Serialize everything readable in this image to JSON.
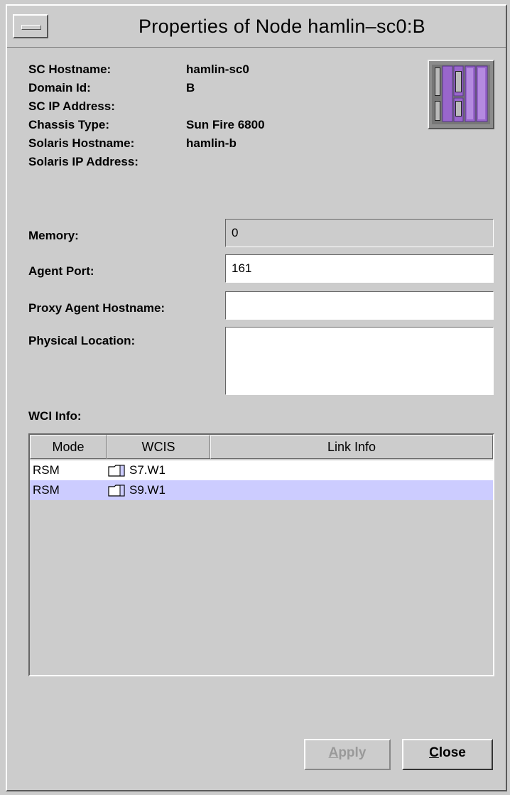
{
  "window": {
    "title": "Properties of Node hamlin–sc0:B"
  },
  "info": [
    {
      "label": "SC Hostname:",
      "value": "hamlin-sc0"
    },
    {
      "label": "Domain Id:",
      "value": "B"
    },
    {
      "label": "SC IP Address:",
      "value": ""
    },
    {
      "label": "Chassis Type:",
      "value": "Sun Fire 6800"
    },
    {
      "label": "Solaris Hostname:",
      "value": "hamlin-b"
    },
    {
      "label": "Solaris IP Address:",
      "value": ""
    }
  ],
  "form": {
    "memory": {
      "label": "Memory:",
      "value": "0"
    },
    "agent_port": {
      "label": "Agent Port:",
      "value": "161"
    },
    "proxy_agent_hostname": {
      "label": "Proxy Agent Hostname:",
      "value": ""
    },
    "physical_location": {
      "label": "Physical Location:",
      "value": ""
    }
  },
  "wci": {
    "label": "WCI Info:",
    "columns": [
      "Mode",
      "WCIS",
      "Link Info"
    ],
    "rows": [
      {
        "mode": "RSM",
        "wcis": "S7.W1",
        "link_info": "",
        "selected": false
      },
      {
        "mode": "RSM",
        "wcis": "S9.W1",
        "link_info": "",
        "selected": true
      }
    ]
  },
  "buttons": {
    "apply": {
      "first": "A",
      "rest": "pply",
      "enabled": false
    },
    "close": {
      "first": "C",
      "rest": "lose",
      "enabled": true
    }
  },
  "colors": {
    "selection": "#ccccff",
    "chassis_board": "#9966cc"
  }
}
